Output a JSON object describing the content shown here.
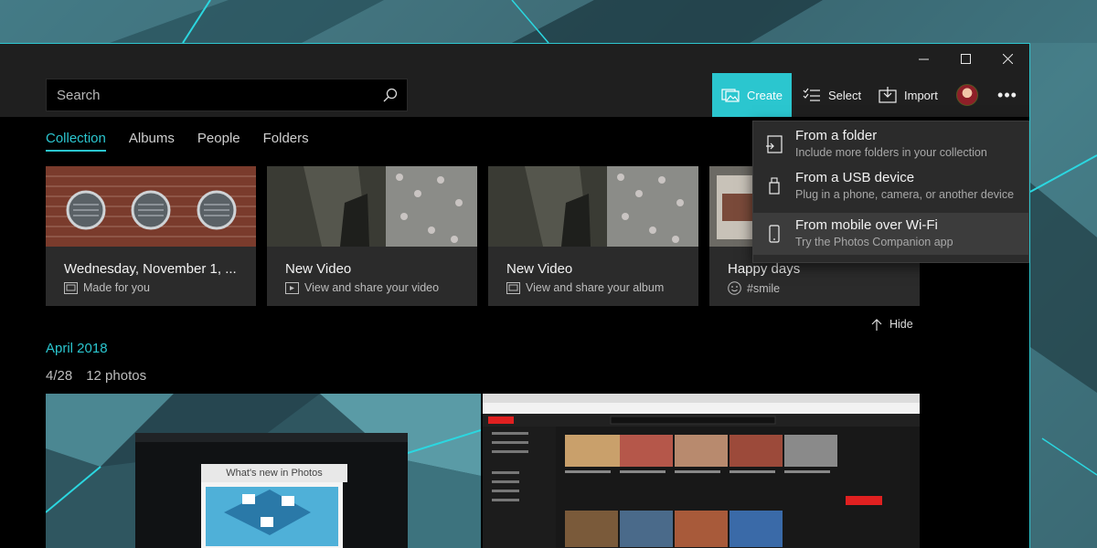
{
  "app": {
    "search": {
      "placeholder": "Search"
    },
    "commands": {
      "create": "Create",
      "select": "Select",
      "import": "Import",
      "more": "•••"
    },
    "tabs": [
      "Collection",
      "Albums",
      "People",
      "Folders"
    ],
    "active_tab": "Collection",
    "cards": [
      {
        "title": "Wednesday, November 1, ...",
        "subtitle": "Made for you",
        "icon": "album-icon"
      },
      {
        "title": "New Video",
        "subtitle": "View and share your video",
        "icon": "video-icon"
      },
      {
        "title": "New Video",
        "subtitle": "View and share your album",
        "icon": "album-icon"
      },
      {
        "title": "Happy days",
        "subtitle": "#smile",
        "icon": "smiley-icon"
      }
    ],
    "hide_label": "Hide",
    "section": {
      "month": "April 2018",
      "date": "4/28",
      "count": "12 photos"
    },
    "photo_caption": "What's new in Photos",
    "import_menu": [
      {
        "title": "From a folder",
        "subtitle": "Include more folders in your collection",
        "icon": "folder-import-icon"
      },
      {
        "title": "From a USB device",
        "subtitle": "Plug in a phone, camera, or another device",
        "icon": "usb-icon"
      },
      {
        "title": "From mobile over Wi-Fi",
        "subtitle": "Try the Photos Companion app",
        "icon": "phone-icon"
      }
    ],
    "accent": "#2bc6cf"
  }
}
